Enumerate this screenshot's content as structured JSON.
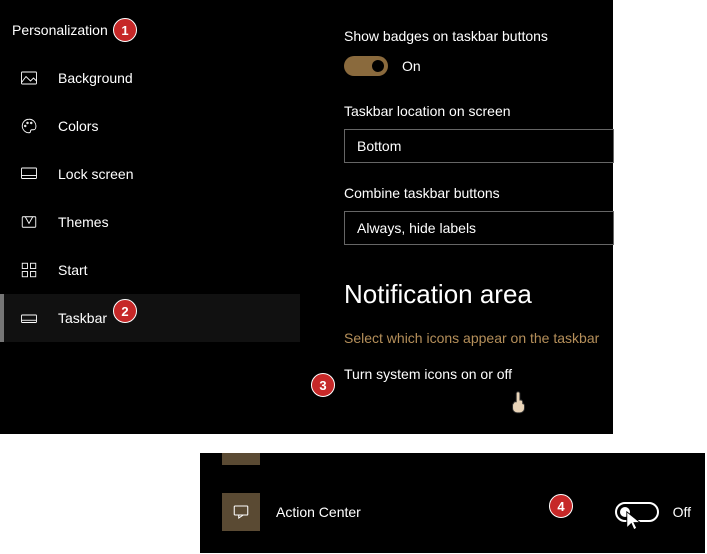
{
  "sidebar": {
    "title": "Personalization",
    "items": [
      {
        "label": "Background"
      },
      {
        "label": "Colors"
      },
      {
        "label": "Lock screen"
      },
      {
        "label": "Themes"
      },
      {
        "label": "Start"
      },
      {
        "label": "Taskbar"
      }
    ]
  },
  "content": {
    "badges_label": "Show badges on taskbar buttons",
    "badges_state": "On",
    "location_label": "Taskbar location on screen",
    "location_value": "Bottom",
    "combine_label": "Combine taskbar buttons",
    "combine_value": "Always, hide labels",
    "notif_heading": "Notification area",
    "link_select_icons": "Select which icons appear on the taskbar",
    "link_system_icons": "Turn system icons on or off"
  },
  "bottom": {
    "item_label": "Action Center",
    "toggle_state": "Off"
  },
  "markers": {
    "m1": "1",
    "m2": "2",
    "m3": "3",
    "m4": "4"
  }
}
